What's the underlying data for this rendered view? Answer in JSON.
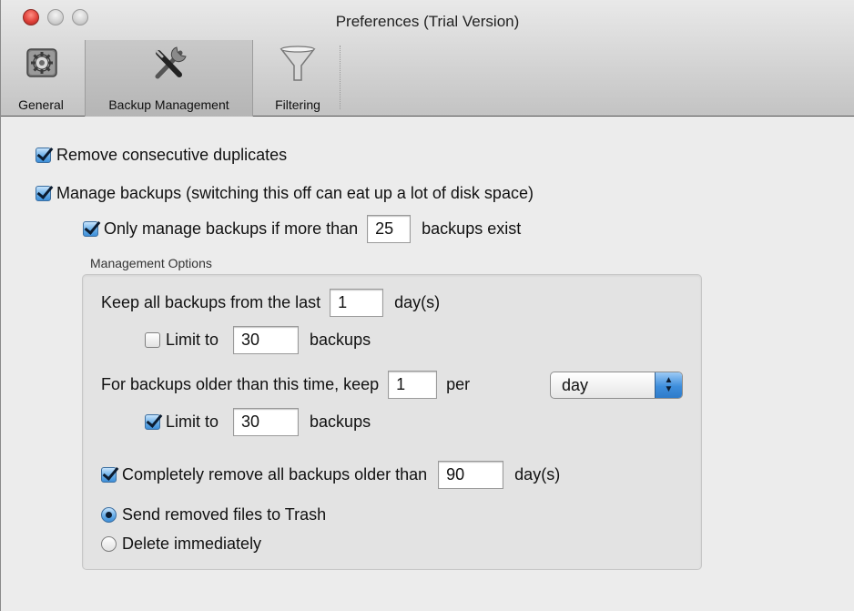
{
  "window": {
    "title": "Preferences (Trial Version)"
  },
  "toolbar": {
    "items": [
      {
        "label": "General",
        "icon": "gear-icon"
      },
      {
        "label": "Backup Management",
        "icon": "tools-icon"
      },
      {
        "label": "Filtering",
        "icon": "funnel-icon"
      }
    ],
    "selected": "Backup Management"
  },
  "options": {
    "remove_duplicates": {
      "label": "Remove consecutive duplicates",
      "checked": true
    },
    "manage_backups": {
      "label": "Manage backups (switching this off can eat up a lot of disk space)",
      "checked": true
    },
    "only_manage": {
      "label": "Only manage backups if more than",
      "value": "25",
      "suffix": "backups exist",
      "checked": true
    }
  },
  "management": {
    "group_label": "Management Options",
    "keep_all": {
      "label": "Keep all backups from the last",
      "value": "1",
      "suffix": "day(s)"
    },
    "limit1": {
      "label": "Limit to",
      "value": "30",
      "suffix": "backups",
      "checked": false
    },
    "older": {
      "label": "For backups older than this time, keep",
      "value": "1",
      "per_label": "per",
      "period": "day"
    },
    "limit2": {
      "label": "Limit to",
      "value": "30",
      "suffix": "backups",
      "checked": true
    },
    "remove_older": {
      "label": "Completely remove all backups older than",
      "value": "90",
      "suffix": "day(s)",
      "checked": true
    },
    "radio_trash": {
      "label": "Send removed files to Trash",
      "checked": true
    },
    "radio_delete": {
      "label": "Delete immediately",
      "checked": false
    }
  },
  "colors": {
    "accent": "#3e8fd8",
    "window_bg": "#ececec",
    "group_bg": "#e3e3e3"
  }
}
